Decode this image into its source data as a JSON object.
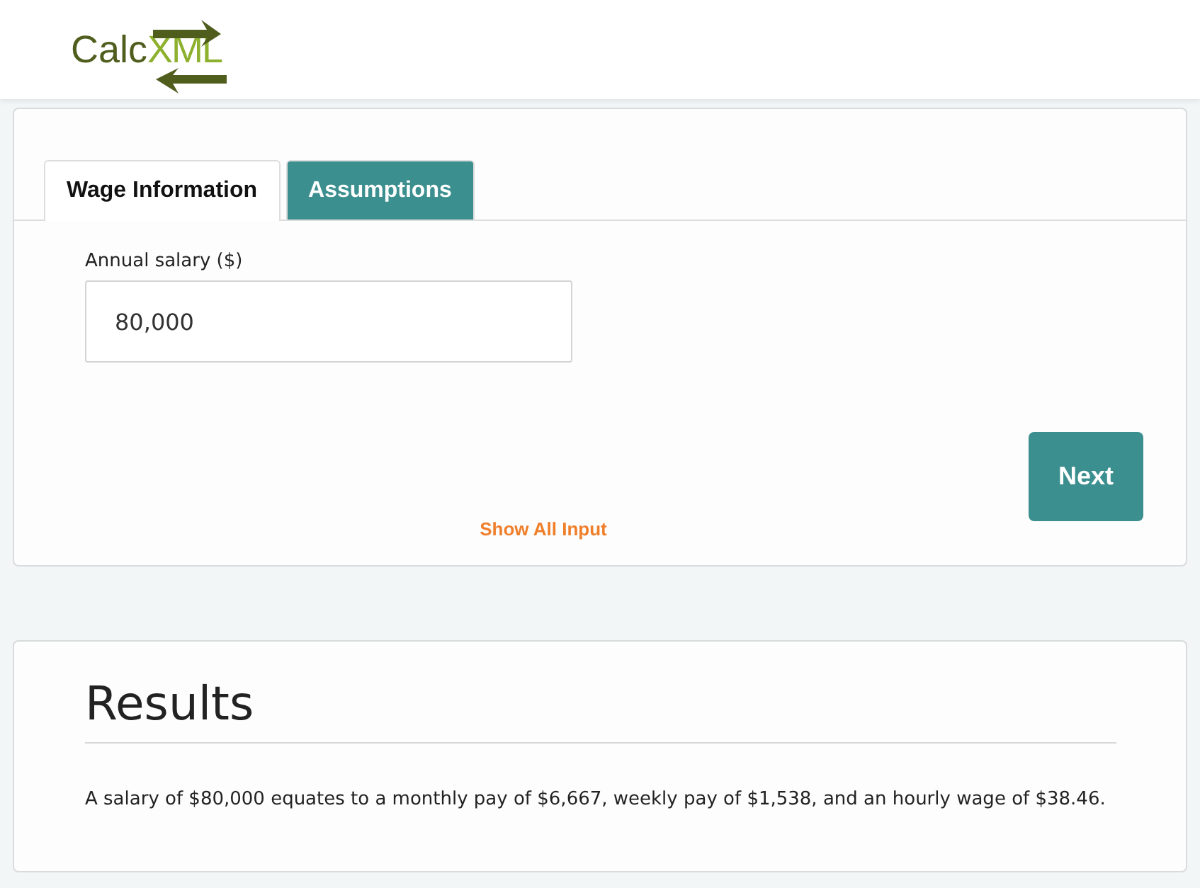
{
  "logo": {
    "part_1": "Calc",
    "part_2": "XML"
  },
  "tabs": [
    {
      "label": "Wage Information",
      "selected": true
    },
    {
      "label": "Assumptions",
      "selected": false
    }
  ],
  "field": {
    "label": "Annual salary ($)",
    "value": "80,000"
  },
  "next_button": "Next",
  "show_all_link": "Show All Input",
  "results": {
    "title": "Results",
    "text": "A salary of $80,000 equates to a monthly pay of $6,667, weekly pay of $1,538, and an hourly wage of $38.46."
  }
}
